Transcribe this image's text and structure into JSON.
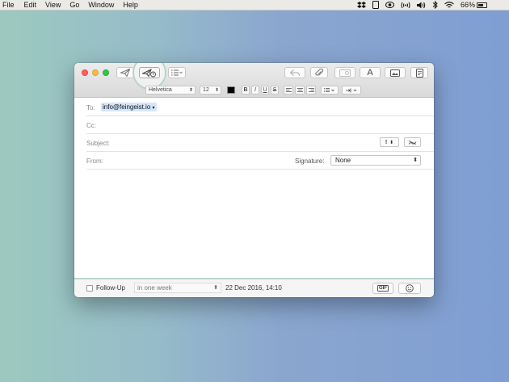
{
  "menubar": {
    "items": [
      "File",
      "Edit",
      "View",
      "Go",
      "Window",
      "Help"
    ],
    "battery_percent": "66%"
  },
  "icons": {
    "send": "paper-plane-icon",
    "send_later": "paper-plane-clock-icon",
    "header_options": "list-options-icon",
    "reply": "reply-arrow-icon",
    "attach": "paperclip-icon",
    "format": "letter-a-icon",
    "photo": "photo-browser-icon",
    "stationery": "stationery-icon"
  },
  "format_bar": {
    "font": "Helvetica",
    "size": "12",
    "bold": "B",
    "italic": "I",
    "underline": "U",
    "strike": "S"
  },
  "headers": {
    "to_label": "To:",
    "to_value": "info@feingeist.io",
    "cc_label": "Cc:",
    "subject_label": "Subject:",
    "priority": "!",
    "from_label": "From:",
    "signature_label": "Signature:",
    "signature_value": "None"
  },
  "footer": {
    "followup_label": "Follow-Up",
    "followup_value": "in one week",
    "date": "22 Dec 2016, 14:10",
    "gif_label": "GIF"
  },
  "colors": {
    "accent_ring": "#b9d4c8",
    "to_chip_bg": "#d3e6fb"
  }
}
